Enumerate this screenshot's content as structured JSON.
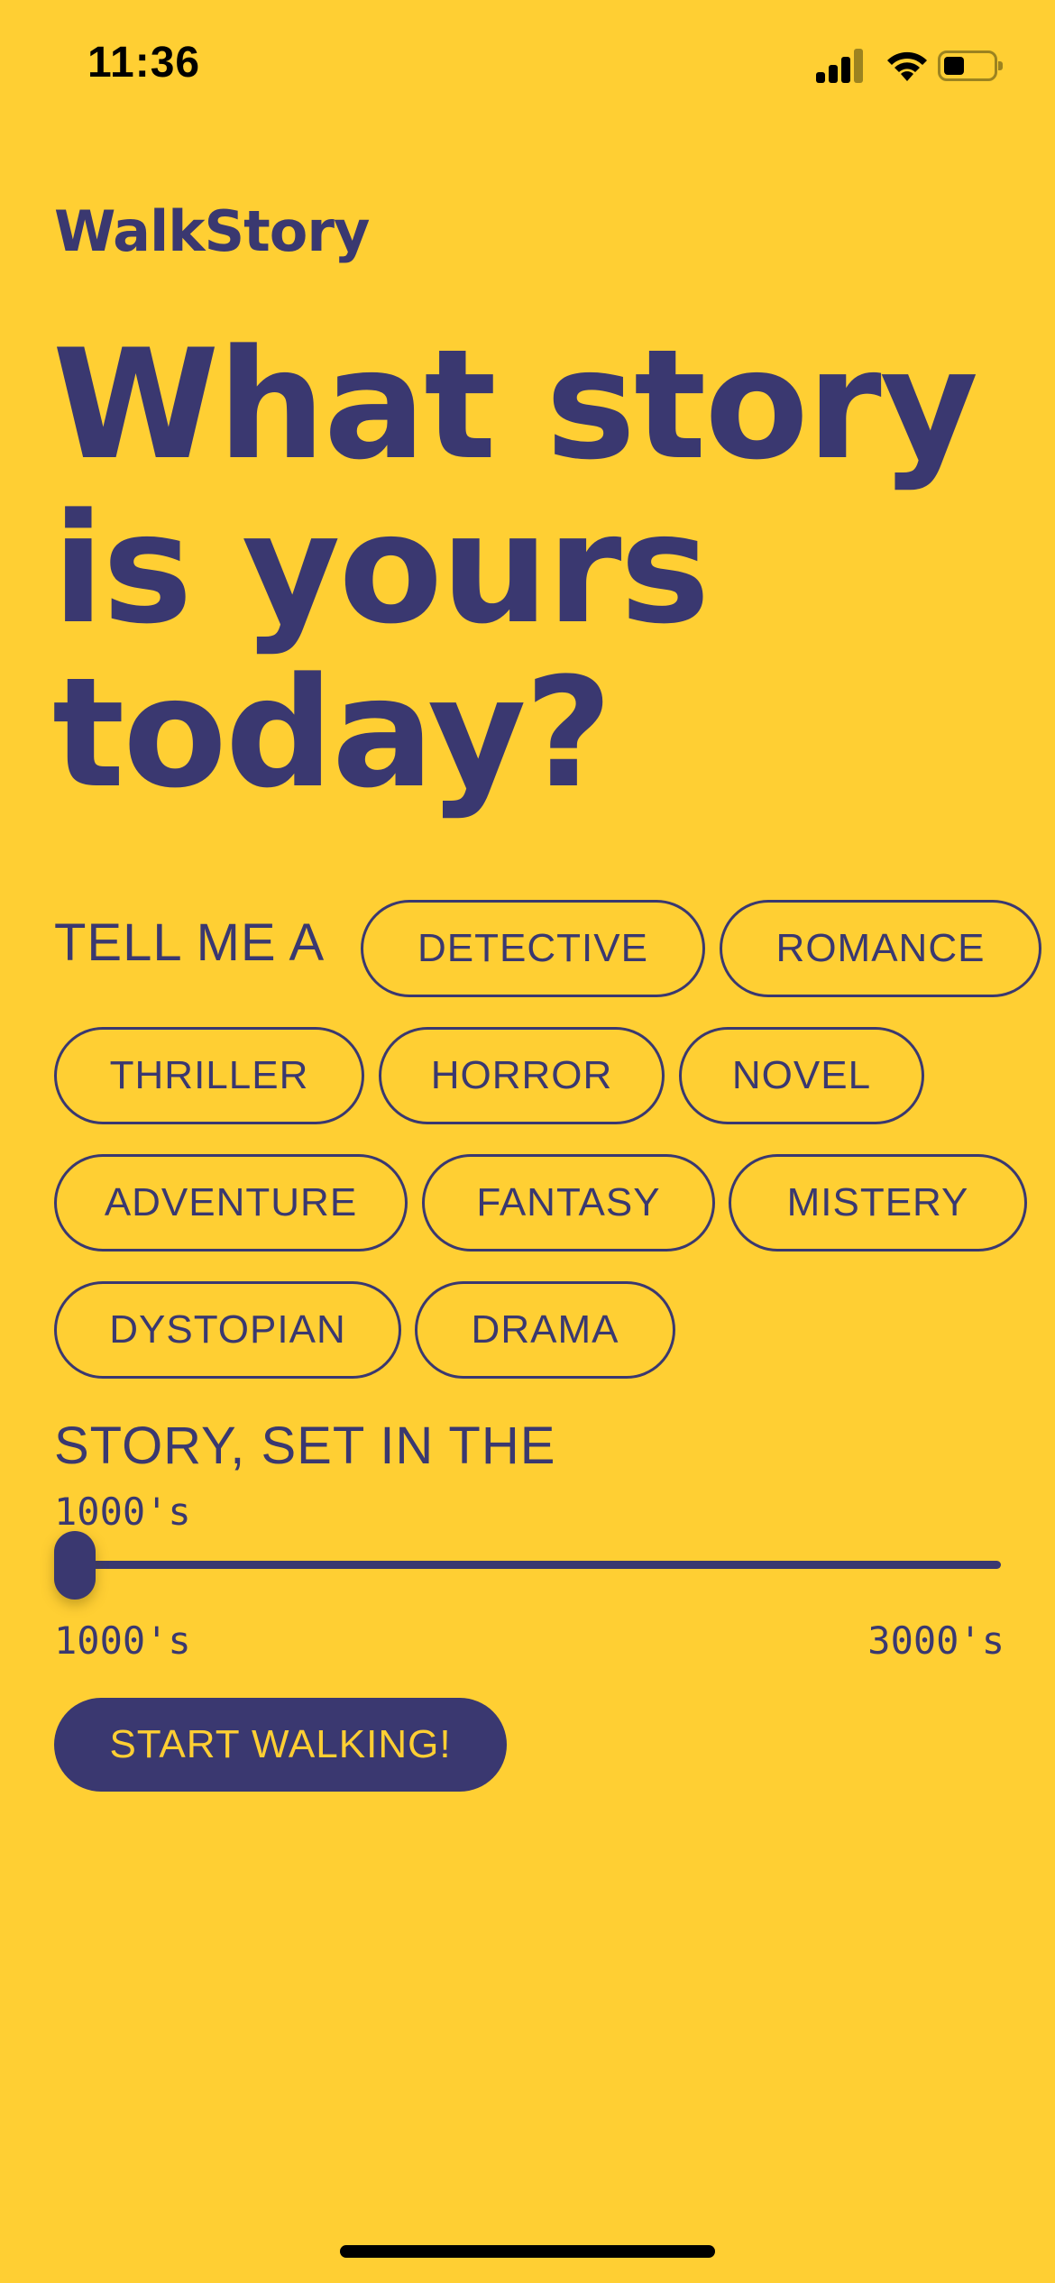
{
  "status_bar": {
    "time": "11:36",
    "icons": [
      "cellular-signal-icon",
      "wifi-icon",
      "battery-icon"
    ]
  },
  "brand": "WalkStory",
  "heading": "What story is yours today?",
  "genre_prompt": "TELL ME A",
  "genres": [
    "DETECTIVE",
    "ROMANCE",
    "THRILLER",
    "HORROR",
    "NOVEL",
    "ADVENTURE",
    "FANTASY",
    "MISTERY",
    "DYSTOPIAN",
    "DRAMA"
  ],
  "era_prompt": "STORY, SET IN THE",
  "slider": {
    "value_label": "1000's",
    "min_label": "1000's",
    "max_label": "3000's",
    "value_fraction": 0
  },
  "start_button": "START WALKING!",
  "colors": {
    "background": "#FFCF33",
    "accent": "#3A3870"
  }
}
